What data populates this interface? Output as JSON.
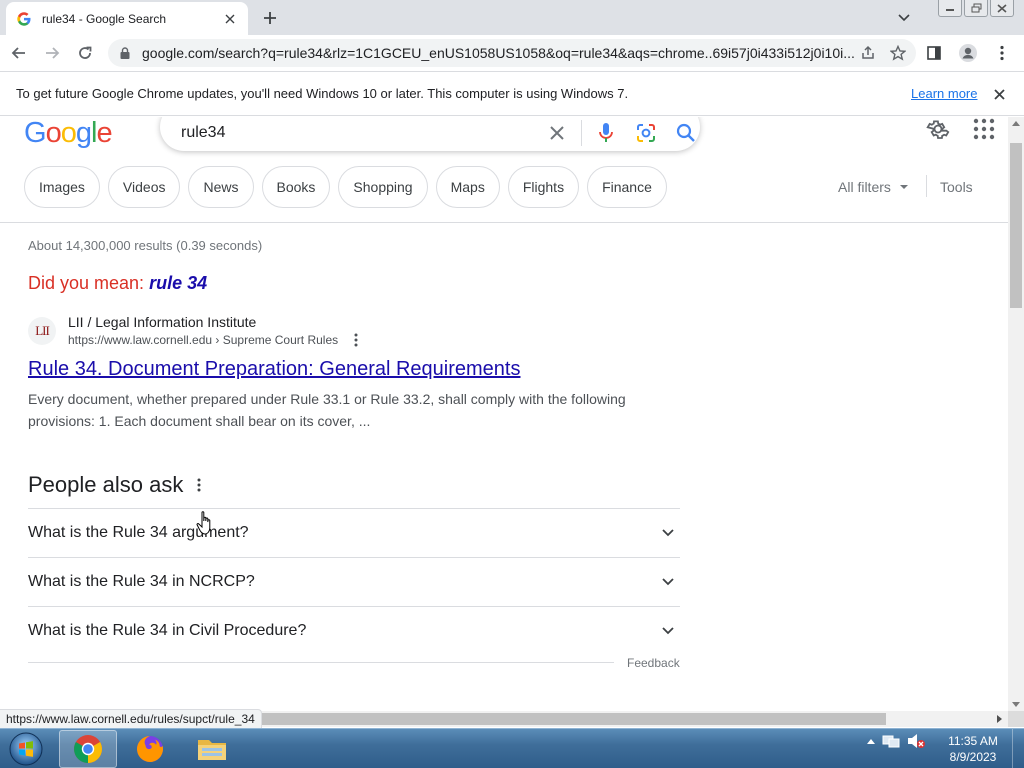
{
  "browser": {
    "tab_title": "rule34 - Google Search",
    "url": "google.com/search?q=rule34&rlz=1C1GCEU_enUS1058US1058&oq=rule34&aqs=chrome..69i57j0i433i512j0i10i..."
  },
  "infobar": {
    "message": "To get future Google Chrome updates, you'll need Windows 10 or later. This computer is using Windows 7.",
    "learn_more": "Learn more"
  },
  "search": {
    "logo": [
      "G",
      "o",
      "o",
      "g",
      "l",
      "e"
    ],
    "logo_colors": [
      "#4285f4",
      "#ea4335",
      "#fbbc05",
      "#4285f4",
      "#34a853",
      "#ea4335"
    ],
    "query": "rule34",
    "chips": [
      "Images",
      "Videos",
      "News",
      "Books",
      "Shopping",
      "Maps",
      "Flights",
      "Finance"
    ],
    "all_filters": "All filters",
    "tools": "Tools",
    "stats": "About 14,300,000 results (0.39 seconds)",
    "did_you_mean_label": "Did you mean:",
    "did_you_mean_value": "rule 34"
  },
  "result": {
    "favicon_text": "LII",
    "site_name": "LII / Legal Information Institute",
    "site_url": "https://www.law.cornell.edu › Supreme Court Rules",
    "title": "Rule 34. Document Preparation: General Requirements",
    "snippet": "Every document, whether prepared under Rule 33.1 or Rule 33.2, shall comply with the following provisions: 1. Each document shall bear on its cover, ..."
  },
  "people_also_ask": {
    "heading": "People also ask",
    "questions": [
      "What is the Rule 34 argument?",
      "What is the Rule 34 in NCRCP?",
      "What is the Rule 34 in Civil Procedure?"
    ],
    "feedback": "Feedback"
  },
  "status_url": "https://www.law.cornell.edu/rules/supct/rule_34",
  "taskbar": {
    "time": "11:35 AM",
    "date": "8/9/2023"
  },
  "colors": {
    "link": "#1a0dab",
    "did_you_mean": "#d93025",
    "chrome_blue": "#1a73e8"
  }
}
